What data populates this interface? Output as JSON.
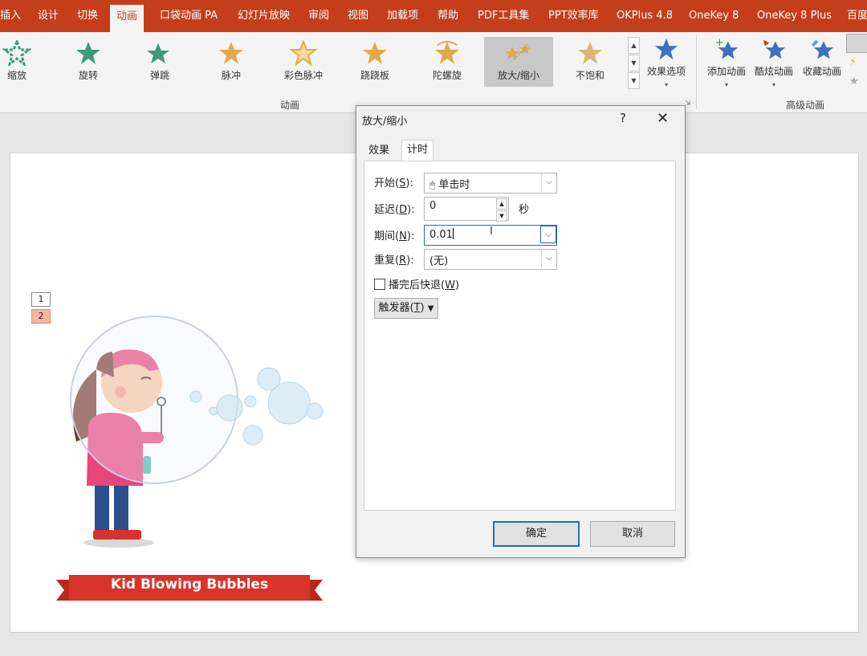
{
  "menu": {
    "items": [
      "插入",
      "设计",
      "切换",
      "动画",
      "口袋动画 PA",
      "幻灯片放映",
      "审阅",
      "视图",
      "加载项",
      "帮助",
      "PDF工具集",
      "PPT效率库",
      "OKPlus 4.8",
      "OneKey 8",
      "OneKey 8 Plus",
      "百度"
    ],
    "active_index": 3
  },
  "ribbon": {
    "gallery": [
      "缩放",
      "旋转",
      "弹跳",
      "脉冲",
      "彩色脉冲",
      "跷跷板",
      "陀螺旋",
      "放大/缩小",
      "不饱和"
    ],
    "gallery_selected": 7,
    "effect_options": "效果选项",
    "group_animation": "动画",
    "add_animation": "添加动画",
    "cool_animation": "酷炫动画",
    "favorite_animation": "收藏动画",
    "group_advanced": "高级动画"
  },
  "slide": {
    "tags": [
      "1",
      "2"
    ],
    "banner_text": "Kid Blowing Bubbles"
  },
  "dialog": {
    "title": "放大/缩小",
    "help": "?",
    "close": "✕",
    "tabs": [
      "效果",
      "计时"
    ],
    "active_tab": 1,
    "start_label": "开始(",
    "start_key": "S",
    "start_value": "单击时",
    "delay_label": "延迟(",
    "delay_key": "D",
    "delay_value": "0",
    "delay_unit": "秒",
    "duration_label": "期间(",
    "duration_key": "N",
    "duration_value": "0.01",
    "repeat_label": "重复(",
    "repeat_key": "R",
    "repeat_value": "(无)",
    "rewind_label": "播完后快退(",
    "rewind_key": "W",
    "trigger_label": "触发器(",
    "trigger_key": "T",
    "ok": "确定",
    "cancel": "取消"
  },
  "colors": {
    "accent": "#c43e1c",
    "star": "#e0a94a",
    "star_green": "#3f9a7a",
    "star_blue": "#3f6fbf"
  }
}
